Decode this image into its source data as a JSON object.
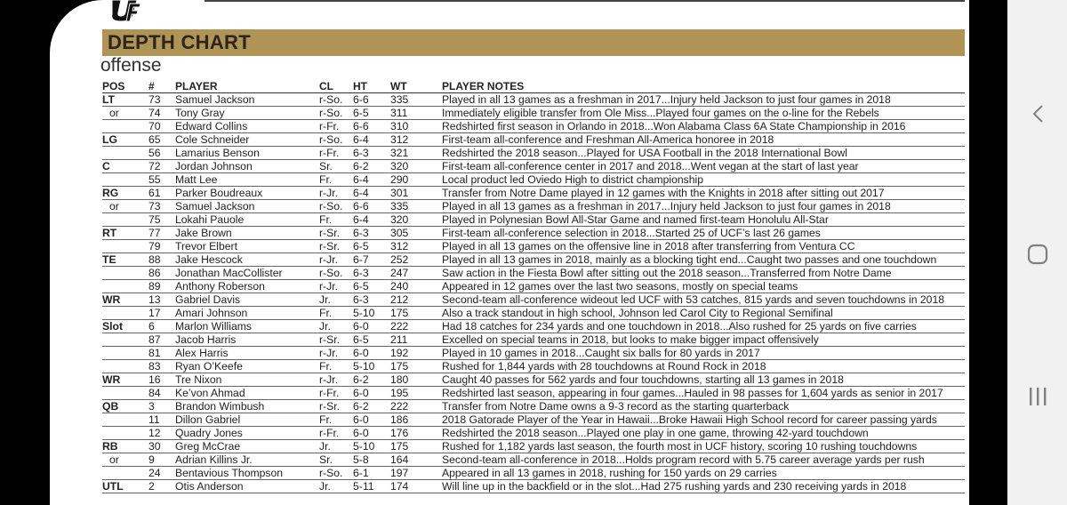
{
  "header": {
    "title": "DEPTH CHART",
    "section": "offense"
  },
  "colors": {
    "header_bar": "#b09455",
    "nav_bg": "#f1f1f1",
    "nav_icon": "#808080"
  },
  "nav": {
    "back_icon": "back-chevron-icon",
    "home_icon": "home-square-icon",
    "recents_icon": "recents-bars-icon"
  },
  "columns": [
    "POS",
    "#",
    "PLAYER",
    "CL",
    "HT",
    "WT",
    "PLAYER NOTES"
  ],
  "rows": [
    {
      "pos": "LT",
      "num": "73",
      "player": "Samuel Jackson",
      "cl": "r-So.",
      "ht": "6-6",
      "wt": "335",
      "notes": "Played in all 13 games as a freshman in 2017...Injury held Jackson to just four games in 2018"
    },
    {
      "pos": "or",
      "num": "74",
      "player": "Tony Gray",
      "cl": "r-So.",
      "ht": "6-5",
      "wt": "311",
      "notes": "Immediately eligible transfer from Ole Miss...Played four games on the o-line for the Rebels"
    },
    {
      "pos": "",
      "num": "70",
      "player": "Edward Collins",
      "cl": "r-Fr.",
      "ht": "6-6",
      "wt": "310",
      "notes": "Redshirted first season in Orlando in 2018...Won Alabama Class 6A State Championship in 2016"
    },
    {
      "pos": "LG",
      "num": "65",
      "player": "Cole Schneider",
      "cl": "r-So.",
      "ht": "6-4",
      "wt": "312",
      "notes": "First-team all-conference and Freshman All-America honoree in 2018"
    },
    {
      "pos": "",
      "num": "56",
      "player": "Lamarius Benson",
      "cl": "r-Fr.",
      "ht": "6-3",
      "wt": "321",
      "notes": "Redshirted the 2018 season...Played for USA Football in the 2018 International Bowl"
    },
    {
      "pos": "C",
      "num": "72",
      "player": "Jordan Johnson",
      "cl": "Sr.",
      "ht": "6-2",
      "wt": "320",
      "notes": "First-team all-conference center in 2017 and 2018...Went vegan at the start of last year"
    },
    {
      "pos": "",
      "num": "55",
      "player": "Matt Lee",
      "cl": "Fr.",
      "ht": "6-4",
      "wt": "290",
      "notes": "Local product led Oviedo High to district championship"
    },
    {
      "pos": "RG",
      "num": "61",
      "player": "Parker Boudreaux",
      "cl": "r-Jr.",
      "ht": "6-4",
      "wt": "301",
      "notes": "Transfer from Notre Dame played in 12 games with the Knights in 2018 after sitting out 2017"
    },
    {
      "pos": "or",
      "num": "73",
      "player": "Samuel Jackson",
      "cl": "r-So.",
      "ht": "6-6",
      "wt": "335",
      "notes": "Played in all 13 games as a freshman in 2017...Injury held Jackson to just four games in 2018"
    },
    {
      "pos": "",
      "num": "75",
      "player": "Lokahi Pauole",
      "cl": "Fr.",
      "ht": "6-4",
      "wt": "320",
      "notes": "Played in Polynesian Bowl All-Star Game and named first-team Honolulu All-Star"
    },
    {
      "pos": "RT",
      "num": "77",
      "player": "Jake Brown",
      "cl": "r-Sr.",
      "ht": "6-3",
      "wt": "305",
      "notes": "First-team all-conference selection in 2018...Started 25 of UCF’s last 26 games"
    },
    {
      "pos": "",
      "num": "79",
      "player": "Trevor Elbert",
      "cl": "r-Sr.",
      "ht": "6-5",
      "wt": "312",
      "notes": "Played in all 13 games on the offensive line in 2018 after transferring from Ventura CC"
    },
    {
      "pos": "TE",
      "num": "88",
      "player": "Jake Hescock",
      "cl": "r-Jr.",
      "ht": "6-7",
      "wt": "252",
      "notes": "Played in all 13 games in 2018, mainly as a blocking tight end...Caught two passes and one touchdown"
    },
    {
      "pos": "",
      "num": "86",
      "player": "Jonathan MacCollister",
      "cl": "r-So.",
      "ht": "6-3",
      "wt": "247",
      "notes": "Saw action in the Fiesta Bowl after sitting out the 2018 season...Transferred from Notre Dame"
    },
    {
      "pos": "",
      "num": "89",
      "player": "Anthony Roberson",
      "cl": "r-Jr.",
      "ht": "6-5",
      "wt": "240",
      "notes": "Appeared in 12 games over the last two seasons, mostly on special teams"
    },
    {
      "pos": "WR",
      "num": "13",
      "player": "Gabriel Davis",
      "cl": "Jr.",
      "ht": "6-3",
      "wt": "212",
      "notes": "Second-team all-conference wideout led UCF with 53 catches, 815 yards and seven touchdowns in 2018"
    },
    {
      "pos": "",
      "num": "17",
      "player": "Amari Johnson",
      "cl": "Fr.",
      "ht": "5-10",
      "wt": "175",
      "notes": "Also a track standout in high school, Johnson led Carol City to Regional Semifinal"
    },
    {
      "pos": "Slot",
      "num": "6",
      "player": "Marlon Williams",
      "cl": "Jr.",
      "ht": "6-0",
      "wt": "222",
      "notes": "Had 18 catches for 234 yards and one touchdown in 2018...Also rushed for 25 yards on five carries"
    },
    {
      "pos": "",
      "num": "87",
      "player": "Jacob Harris",
      "cl": "r-Sr.",
      "ht": "6-5",
      "wt": "211",
      "notes": "Excelled on special teams in 2018, but looks to make bigger impact offensively"
    },
    {
      "pos": "",
      "num": "81",
      "player": "Alex Harris",
      "cl": "r-Jr.",
      "ht": "6-0",
      "wt": "192",
      "notes": "Played in 10 games in 2018...Caught six balls for 80 yards in 2017"
    },
    {
      "pos": "",
      "num": "83",
      "player": "Ryan O’Keefe",
      "cl": "Fr.",
      "ht": "5-10",
      "wt": "175",
      "notes": "Rushed for 1,844 yards with 28 touchdowns at Round Rock in 2018"
    },
    {
      "pos": "WR",
      "num": "16",
      "player": "Tre Nixon",
      "cl": "r-Jr.",
      "ht": "6-2",
      "wt": "180",
      "notes": "Caught 40 passes for 562 yards and four touchdowns, starting all 13 games in 2018"
    },
    {
      "pos": "",
      "num": "84",
      "player": "Ke’von Ahmad",
      "cl": "r-Fr.",
      "ht": "6-0",
      "wt": "195",
      "notes": "Redshirted last season, appearing in four games...Hauled in 98 passes for 1,604 yards as senior in 2017"
    },
    {
      "pos": "QB",
      "num": "3",
      "player": "Brandon Wimbush",
      "cl": "r-Sr.",
      "ht": "6-2",
      "wt": "222",
      "notes": "Transfer from Notre Dame owns a 9-3 record as the starting quarterback"
    },
    {
      "pos": "",
      "num": "11",
      "player": "Dillon Gabriel",
      "cl": "Fr.",
      "ht": "6-0",
      "wt": "186",
      "notes": "2018 Gatorade Player of the Year in Hawaii...Broke Hawaii High School record for career passing yards"
    },
    {
      "pos": "",
      "num": "12",
      "player": "Quadry Jones",
      "cl": "r-Fr.",
      "ht": "6-0",
      "wt": "176",
      "notes": "Redshirted the 2018 season...Played one play in one game, throwing 42-yard touchdown"
    },
    {
      "pos": "RB",
      "num": "30",
      "player": "Greg McCrae",
      "cl": "Jr.",
      "ht": "5-10",
      "wt": "175",
      "notes": "Rushed for 1,182 yards last season, the fourth most in UCF history, scoring 10 rushing touchdowns"
    },
    {
      "pos": "or",
      "num": "9",
      "player": "Adrian Killins Jr.",
      "cl": "Sr.",
      "ht": "5-8",
      "wt": "164",
      "notes": "Second-team all-conference in 2018...Holds program record with 5.75 career average yards per rush"
    },
    {
      "pos": "",
      "num": "24",
      "player": "Bentavious Thompson",
      "cl": "r-So.",
      "ht": "6-1",
      "wt": "197",
      "notes": "Appeared in all 13 games in 2018, rushing for 150 yards on 29 carries"
    },
    {
      "pos": "UTL",
      "num": "2",
      "player": "Otis Anderson",
      "cl": "Jr.",
      "ht": "5-11",
      "wt": "174",
      "notes": "Will line up in the backfield or in the slot...Had 275 rushing yards and 230 receiving yards in 2018"
    }
  ]
}
